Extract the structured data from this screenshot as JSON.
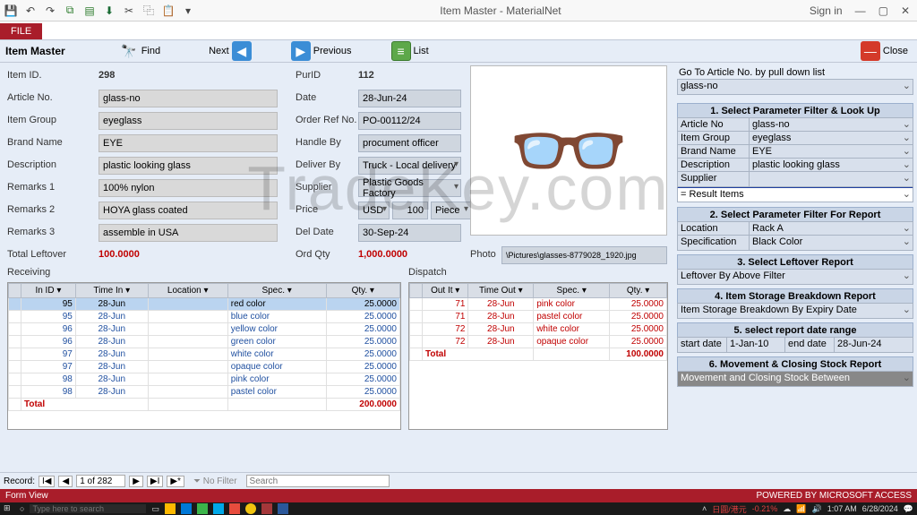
{
  "app": {
    "title": "Item Master - MaterialNet",
    "signin": "Sign in",
    "file": "FILE"
  },
  "actions": {
    "item_master": "Item Master",
    "find": "Find",
    "next": "Next",
    "previous": "Previous",
    "list": "List",
    "close": "Close"
  },
  "left": {
    "item_id_l": "Item ID.",
    "item_id": "298",
    "article_l": "Article No.",
    "article": "glass-no",
    "group_l": "Item Group",
    "group": "eyeglass",
    "brand_l": "Brand Name",
    "brand": "EYE",
    "desc_l": "Description",
    "desc": "plastic looking glass",
    "rem1_l": "Remarks 1",
    "rem1": "100% nylon",
    "rem2_l": "Remarks 2",
    "rem2": "HOYA glass coated",
    "rem3_l": "Remarks 3",
    "rem3": "assemble in USA",
    "lo_l": "Total Leftover",
    "lo": "100.0000"
  },
  "mid": {
    "purid_l": "PurID",
    "purid": "112",
    "date_l": "Date",
    "date": "28-Jun-24",
    "ordref_l": "Order Ref No.",
    "ordref": "PO-00112/24",
    "handle_l": "Handle By",
    "handle": "procument officer",
    "deliver_l": "Deliver By",
    "deliver": "Truck - Local delivery",
    "supplier_l": "Supplier",
    "supplier": "Plastic Goods Factory",
    "price_l": "Price",
    "price_cur": "USD",
    "price_val": "100",
    "price_unit": "Piece",
    "deldate_l": "Del Date",
    "deldate": "30-Sep-24",
    "ordqty_l": "Ord Qty",
    "ordqty": "1,000.0000",
    "photo_l": "Photo",
    "photo": "\\Pictures\\glasses-8779028_1920.jpg"
  },
  "rp": {
    "goto_t": "Go To Article No. by pull down list",
    "goto_v": "glass-no",
    "p1_t": "1. Select Parameter Filter & Look Up",
    "p1_rows": [
      [
        "Article No",
        "glass-no"
      ],
      [
        "Item Group",
        "eyeglass"
      ],
      [
        "Brand Name",
        "EYE"
      ],
      [
        "Description",
        "plastic looking glass"
      ],
      [
        "Supplier",
        ""
      ]
    ],
    "p1_res": "= Result Items",
    "p2_t": "2. Select Parameter Filter For Report",
    "p2_rows": [
      [
        "Location",
        "Rack A"
      ],
      [
        "Specification",
        "Black Color"
      ]
    ],
    "p3_t": "3. Select Leftover Report",
    "p3_v": "Leftover By Above Filter",
    "p4_t": "4. Item Storage Breakdown Report",
    "p4_v": "Item Storage Breakdown By Expiry Date",
    "p5_t": "5. select report date range",
    "p5_sl": "start date",
    "p5_sv": "1-Jan-10",
    "p5_el": "end date",
    "p5_ev": "28-Jun-24",
    "p6_t": "6. Movement & Closing Stock Report",
    "p6_v": "Movement and Closing Stock Between"
  },
  "recv": {
    "title": "Receiving",
    "h": [
      "In ID",
      "Time In",
      "Location",
      "Spec.",
      "Qty."
    ],
    "rows": [
      [
        "95",
        "28-Jun",
        "",
        "red color",
        "25.0000"
      ],
      [
        "95",
        "28-Jun",
        "",
        "blue color",
        "25.0000"
      ],
      [
        "96",
        "28-Jun",
        "",
        "yellow color",
        "25.0000"
      ],
      [
        "96",
        "28-Jun",
        "",
        "green color",
        "25.0000"
      ],
      [
        "97",
        "28-Jun",
        "",
        "white color",
        "25.0000"
      ],
      [
        "97",
        "28-Jun",
        "",
        "opaque color",
        "25.0000"
      ],
      [
        "98",
        "28-Jun",
        "",
        "pink color",
        "25.0000"
      ],
      [
        "98",
        "28-Jun",
        "",
        "pastel color",
        "25.0000"
      ]
    ],
    "total_l": "Total",
    "total": "200.0000"
  },
  "disp": {
    "title": "Dispatch",
    "h": [
      "Out It",
      "Time Out",
      "Spec.",
      "Qty."
    ],
    "rows": [
      [
        "71",
        "28-Jun",
        "pink color",
        "25.0000"
      ],
      [
        "71",
        "28-Jun",
        "pastel color",
        "25.0000"
      ],
      [
        "72",
        "28-Jun",
        "white color",
        "25.0000"
      ],
      [
        "72",
        "28-Jun",
        "opaque color",
        "25.0000"
      ]
    ],
    "total_l": "Total",
    "total": "100.0000"
  },
  "nav": {
    "record": "Record:",
    "pos": "1 of 282",
    "nofilter": "No Filter",
    "search_ph": "Search"
  },
  "status": {
    "left": "Form View",
    "right": "POWERED BY MICROSOFT ACCESS"
  },
  "tb": {
    "search_ph": "Type here to search",
    "cur": "日圓/港元",
    "rate": "-0.21%",
    "time": "1:07 AM",
    "date": "6/28/2024"
  },
  "wm": "TradeKey.com"
}
